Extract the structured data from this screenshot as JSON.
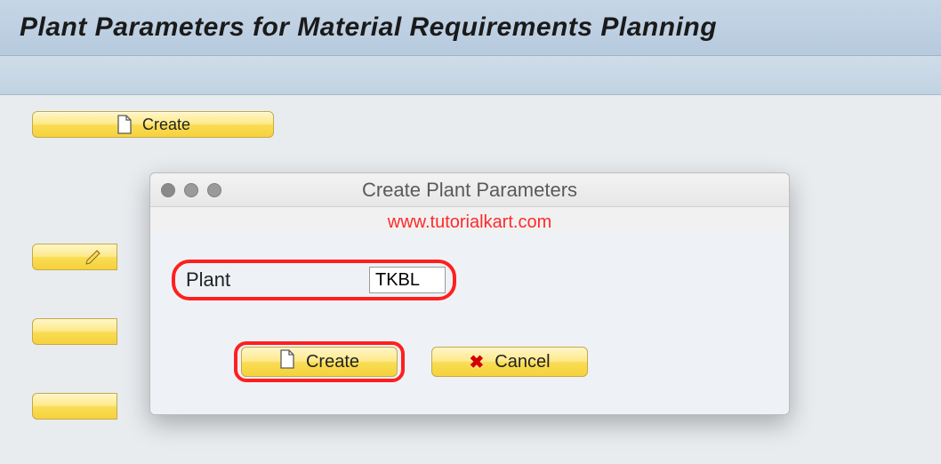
{
  "page": {
    "title": "Plant Parameters for Material Requirements Planning"
  },
  "main": {
    "create_label": "Create"
  },
  "dialog": {
    "title": "Create Plant Parameters",
    "watermark": "www.tutorialkart.com",
    "field_label": "Plant",
    "field_value": "TKBL",
    "create_label": "Create",
    "cancel_label": "Cancel"
  }
}
